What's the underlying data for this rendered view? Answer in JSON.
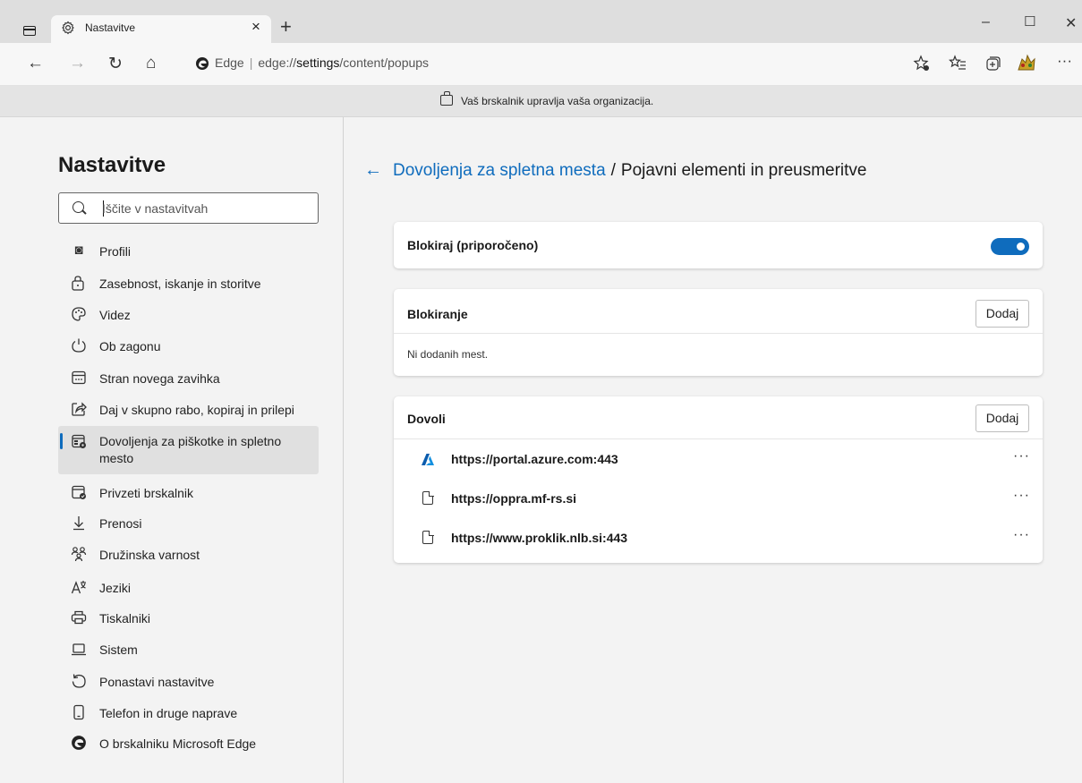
{
  "browser": {
    "tab_title": "Nastavitve",
    "tab_close": "×",
    "new_tab": "+",
    "window_controls": {
      "minimize": "–",
      "maximize": "☐",
      "close": "✕"
    },
    "nav": {
      "back": "←",
      "forward": "→",
      "reload": "↻",
      "home": "⌂"
    },
    "url_brand": "Edge",
    "url_prefix": "edge://",
    "url_host": "settings",
    "url_path": "/content/popups",
    "toolbar_more": "···"
  },
  "infobar": {
    "text": "Vaš brskalnik upravlja vaša organizacija."
  },
  "sidebar": {
    "title": "Nastavitve",
    "search_placeholder": "Iščite v nastavitvah",
    "items": [
      {
        "label": "Profili",
        "icon": "profile-icon"
      },
      {
        "label": "Zasebnost, iskanje in storitve",
        "icon": "lock-icon"
      },
      {
        "label": "Videz",
        "icon": "palette-icon"
      },
      {
        "label": "Ob zagonu",
        "icon": "power-icon"
      },
      {
        "label": "Stran novega zavihka",
        "icon": "new-tab-page-icon"
      },
      {
        "label": "Daj v skupno rabo, kopiraj in prilepi",
        "icon": "share-icon"
      },
      {
        "label": "Dovoljenja za piškotke in spletno mesto",
        "icon": "site-permissions-icon",
        "selected": true
      },
      {
        "label": "Privzeti brskalnik",
        "icon": "default-browser-icon"
      },
      {
        "label": "Prenosi",
        "icon": "download-icon"
      },
      {
        "label": "Družinska varnost",
        "icon": "family-icon"
      },
      {
        "label": "Jeziki",
        "icon": "languages-icon"
      },
      {
        "label": "Tiskalniki",
        "icon": "printer-icon"
      },
      {
        "label": "Sistem",
        "icon": "laptop-icon"
      },
      {
        "label": "Ponastavi nastavitve",
        "icon": "reset-icon"
      },
      {
        "label": "Telefon in druge naprave",
        "icon": "phone-icon"
      },
      {
        "label": "O brskalniku Microsoft Edge",
        "icon": "edge-logo-icon"
      }
    ]
  },
  "main": {
    "breadcrumb_back": "←",
    "breadcrumb_parent": "Dovoljenja za spletna mesta",
    "breadcrumb_separator": "/",
    "breadcrumb_current": "Pojavni elementi in preusmeritve",
    "block_card": {
      "label": "Blokiraj (priporočeno)",
      "toggle_on": true
    },
    "blocking_card": {
      "title": "Blokiranje",
      "add_label": "Dodaj",
      "empty_text": "Ni dodanih mest."
    },
    "allow_card": {
      "title": "Dovoli",
      "add_label": "Dodaj",
      "sites": [
        {
          "url": "https://portal.azure.com:443",
          "icon": "azure-icon",
          "more": "···"
        },
        {
          "url": "https://oppra.mf-rs.si",
          "icon": "page-icon",
          "more": "···"
        },
        {
          "url": "https://www.proklik.nlb.si:443",
          "icon": "page-icon",
          "more": "···"
        }
      ]
    }
  },
  "colors": {
    "accent": "#0f6cbd",
    "sidebar_bg": "#f3f3f3",
    "selected_bg": "#e0e0e0"
  }
}
